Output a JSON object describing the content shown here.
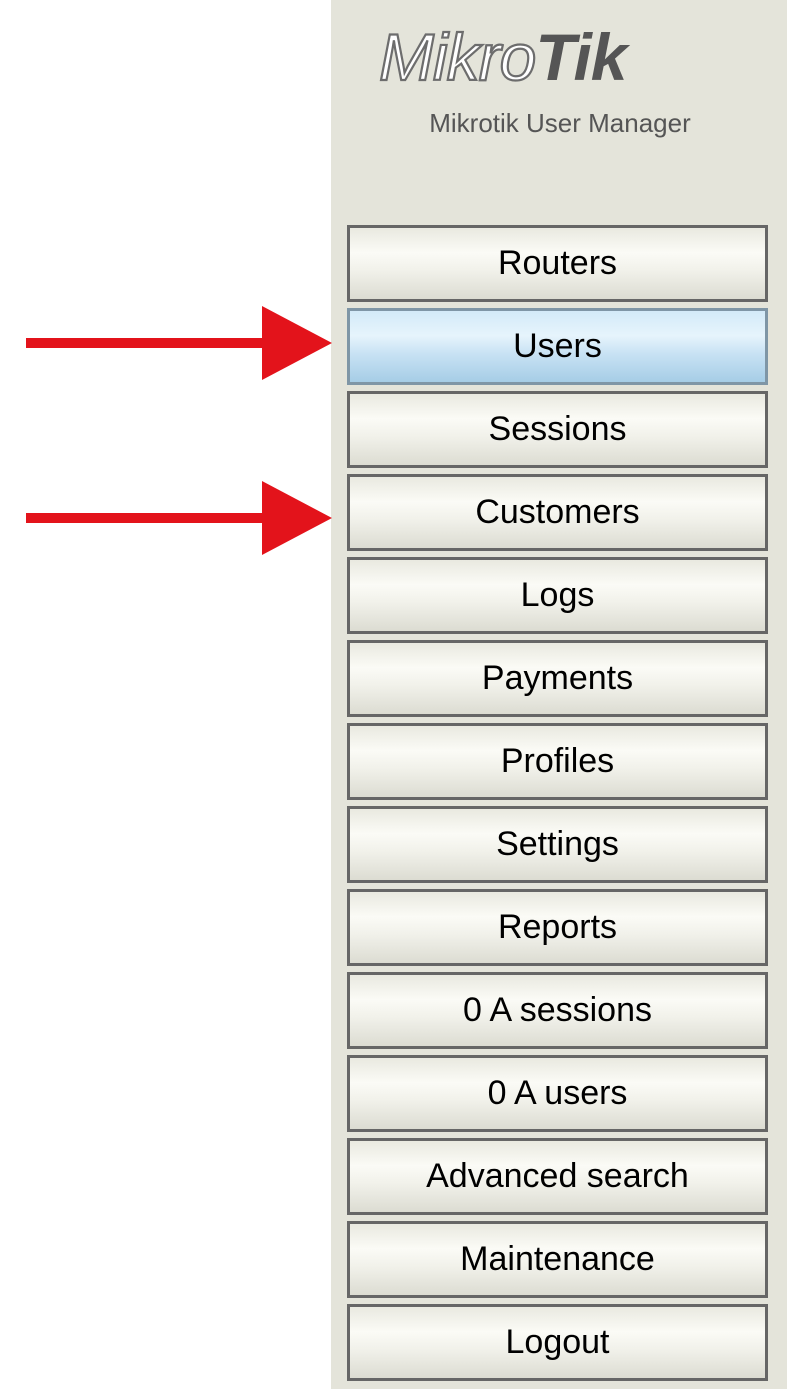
{
  "app": {
    "logo_text_light": "Mikro",
    "logo_text_bold": "Tik",
    "subtitle": "Mikrotik User Manager"
  },
  "nav": {
    "selected": "Users",
    "items": [
      {
        "label": "Routers"
      },
      {
        "label": "Users"
      },
      {
        "label": "Sessions"
      },
      {
        "label": "Customers"
      },
      {
        "label": "Logs"
      },
      {
        "label": "Payments"
      },
      {
        "label": "Profiles"
      },
      {
        "label": "Settings"
      },
      {
        "label": "Reports"
      },
      {
        "label": "0 A sessions"
      },
      {
        "label": "0 A users"
      },
      {
        "label": "Advanced search"
      },
      {
        "label": "Maintenance"
      },
      {
        "label": "Logout"
      }
    ]
  },
  "annotations": {
    "arrow_color": "#e3131b",
    "arrows": [
      {
        "points_to": "Users",
        "icon": "arrow-right-icon"
      },
      {
        "points_to": "Customers",
        "icon": "arrow-right-icon"
      }
    ]
  },
  "colors": {
    "sidebar_background": "#e4e4da",
    "button_border": "#666666",
    "selected_button": "#c8e2f4"
  }
}
